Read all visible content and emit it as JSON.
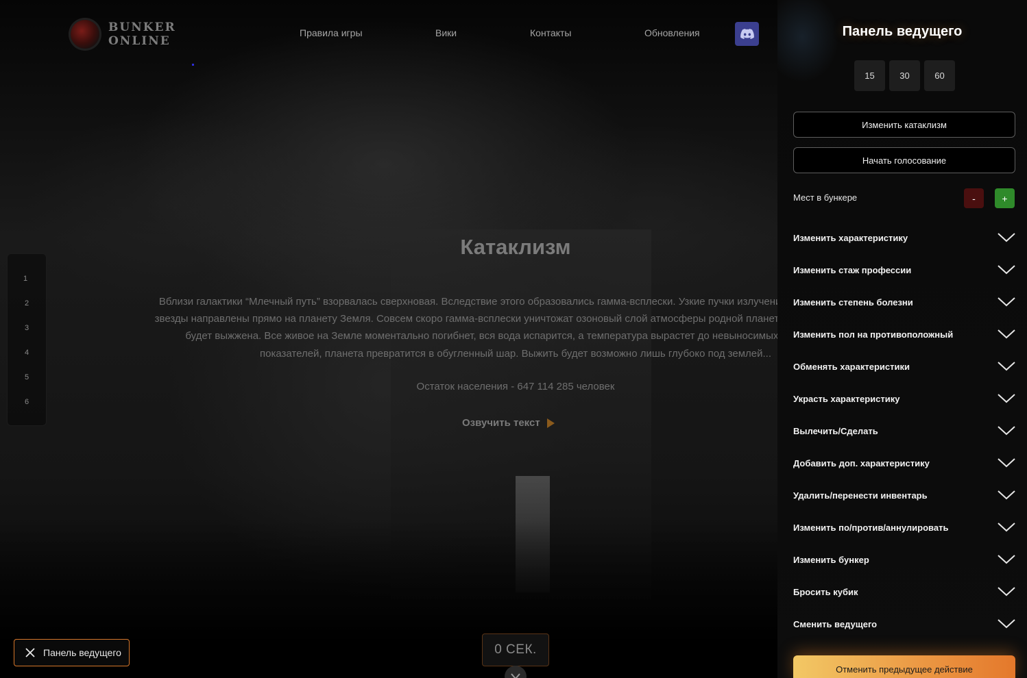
{
  "header": {
    "logo_line1": "BUNKER",
    "logo_line2": "ONLINE",
    "nav": [
      "Правила игры",
      "Вики",
      "Контакты",
      "Обновления"
    ],
    "discord_icon": "discord-icon"
  },
  "rounds": [
    "1",
    "2",
    "3",
    "4",
    "5",
    "6"
  ],
  "main": {
    "title": "Катаклизм",
    "description": "Вблизи галактики “Млечный путь” взорвалась сверхновая. Вследствие этого образовались гамма-всплески. Узкие пучки излучения коллапсирующей звезды направлены прямо на планету Земля. Совсем скоро гамма-всплески уничтожат озоновый слой атмосферы родной планеты и вся поверхность будет выжжена. Все живое на Земле моментально погибнет, вся вода испарится, а температура вырастет до невыносимых для человека показателей, планета превратится в обугленный шар. Выжить будет возможно лишь глубоко под землей...",
    "population": "Остаток населения - 647 114 285 человек",
    "voice_label": "Озвучить текст"
  },
  "timer": {
    "value": "0 СЕК."
  },
  "panel_toggle": {
    "label": "Панель ведущего"
  },
  "panel": {
    "title": "Панель ведущего",
    "times": [
      "15",
      "30",
      "60"
    ],
    "change_cataclysm": "Изменить катаклизм",
    "start_vote": "Начать голосование",
    "seats_label": "Мест в бункере",
    "minus": "-",
    "plus": "+",
    "actions": [
      "Изменить характеристику",
      "Изменить стаж профессии",
      "Изменить степень болезни",
      "Изменить пол на противоположный",
      "Обменять характеристики",
      "Украсть характеристику",
      "Вылечить/Сделать",
      "Добавить доп. характеристику",
      "Удалить/перенести инвентарь",
      "Изменить по/против/аннулировать",
      "Изменить бункер",
      "Бросить кубик",
      "Сменить ведущего"
    ],
    "undo": "Отменить предыдущее действие"
  },
  "colors": {
    "accent_orange": "#e4782b",
    "minus_btn": "#4a0f0f",
    "plus_btn": "#2f8a2a",
    "discord": "#3b3f8f"
  }
}
